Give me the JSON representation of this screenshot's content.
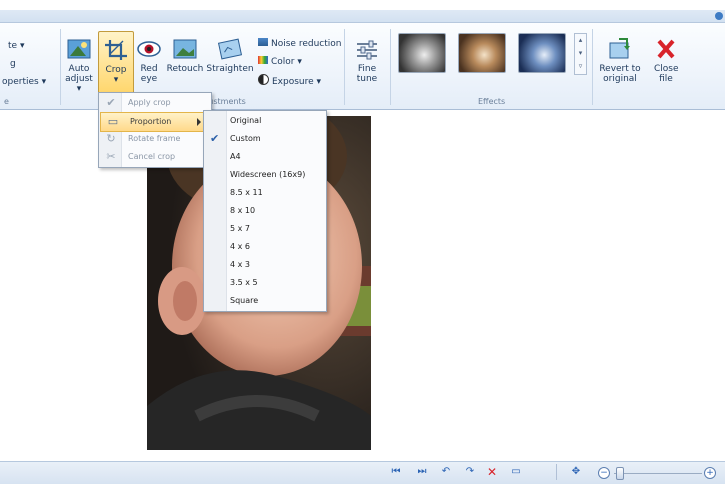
{
  "ribbon": {
    "left_group": {
      "items": [
        "te",
        "g",
        "operties"
      ],
      "group_label": "e"
    },
    "auto_adjust": "Auto adjust",
    "crop": "Crop",
    "red_eye": "Red eye",
    "retouch": "Retouch",
    "straighten": "Straighten",
    "noise_reduction": "Noise reduction",
    "color": "Color",
    "exposure": "Exposure",
    "adjustments_label": "djustments",
    "fine_tune": "Fine tune",
    "effects_label": "Effects",
    "revert": "Revert to original",
    "close": "Close file"
  },
  "crop_menu": {
    "items": [
      {
        "label": "Apply crop",
        "icon": "checkmark-icon"
      },
      {
        "label": "Proportion",
        "icon": "proportion-icon"
      },
      {
        "label": "Rotate frame",
        "icon": "rotate-frame-icon"
      },
      {
        "label": "Cancel crop",
        "icon": "cancel-crop-icon"
      }
    ]
  },
  "proportion_menu": {
    "items": [
      "Original",
      "Custom",
      "A4",
      "Widescreen (16x9)",
      "8.5 x 11",
      "8 x 10",
      "5 x 7",
      "4 x 6",
      "4 x 3",
      "3.5 x 5",
      "Square"
    ],
    "checked": "Custom"
  },
  "colors": {
    "accent": "#2b63b4",
    "crop_highlight": "#ffd66b",
    "close_red": "#d8232a"
  },
  "statusbar": {
    "icons": [
      "previous-icon",
      "next-icon",
      "rotate-left-icon",
      "rotate-right-icon",
      "delete-icon",
      "slideshow-icon",
      "fit-icon",
      "zoom-out-icon",
      "zoom-in-icon"
    ]
  }
}
